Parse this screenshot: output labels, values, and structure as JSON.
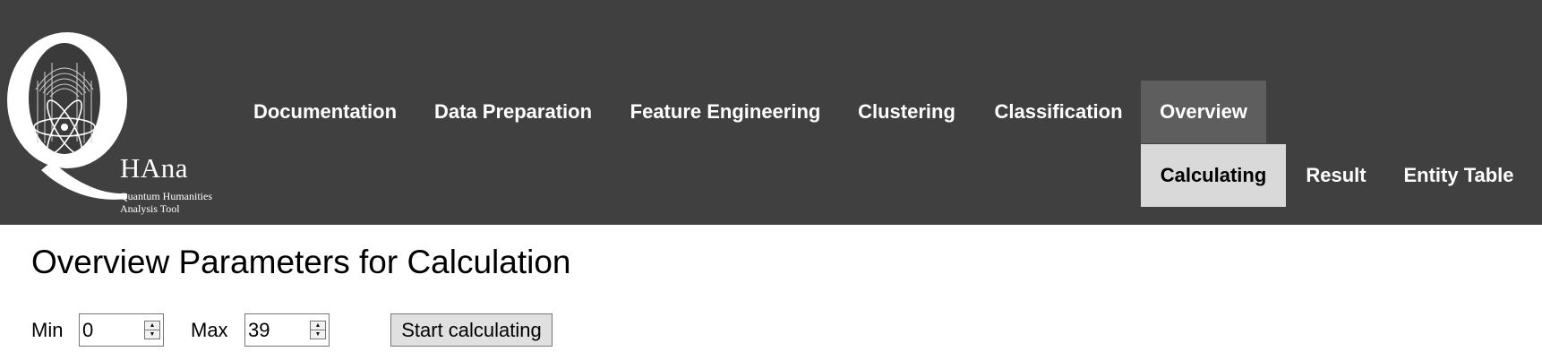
{
  "logo": {
    "letter": "Q",
    "brand": "HAna",
    "subtitle_line1": "Quantum Humanities",
    "subtitle_line2": "Analysis Tool"
  },
  "nav": {
    "items": [
      {
        "label": "Documentation",
        "active": false
      },
      {
        "label": "Data Preparation",
        "active": false
      },
      {
        "label": "Feature Engineering",
        "active": false
      },
      {
        "label": "Clustering",
        "active": false
      },
      {
        "label": "Classification",
        "active": false
      },
      {
        "label": "Overview",
        "active": true
      }
    ],
    "subitems": [
      {
        "label": "Calculating",
        "active": true
      },
      {
        "label": "Result",
        "active": false
      },
      {
        "label": "Entity Table",
        "active": false
      }
    ]
  },
  "main": {
    "title": "Overview Parameters for Calculation",
    "min_label": "Min",
    "min_value": "0",
    "max_label": "Max",
    "max_value": "39",
    "start_label": "Start calculating"
  },
  "colors": {
    "header_bg": "#404040",
    "nav_active_bg": "#5e5e5e",
    "subnav_active_bg": "#d9d9d9"
  },
  "icons": {
    "spinner_up": "▲",
    "spinner_down": "▼"
  }
}
